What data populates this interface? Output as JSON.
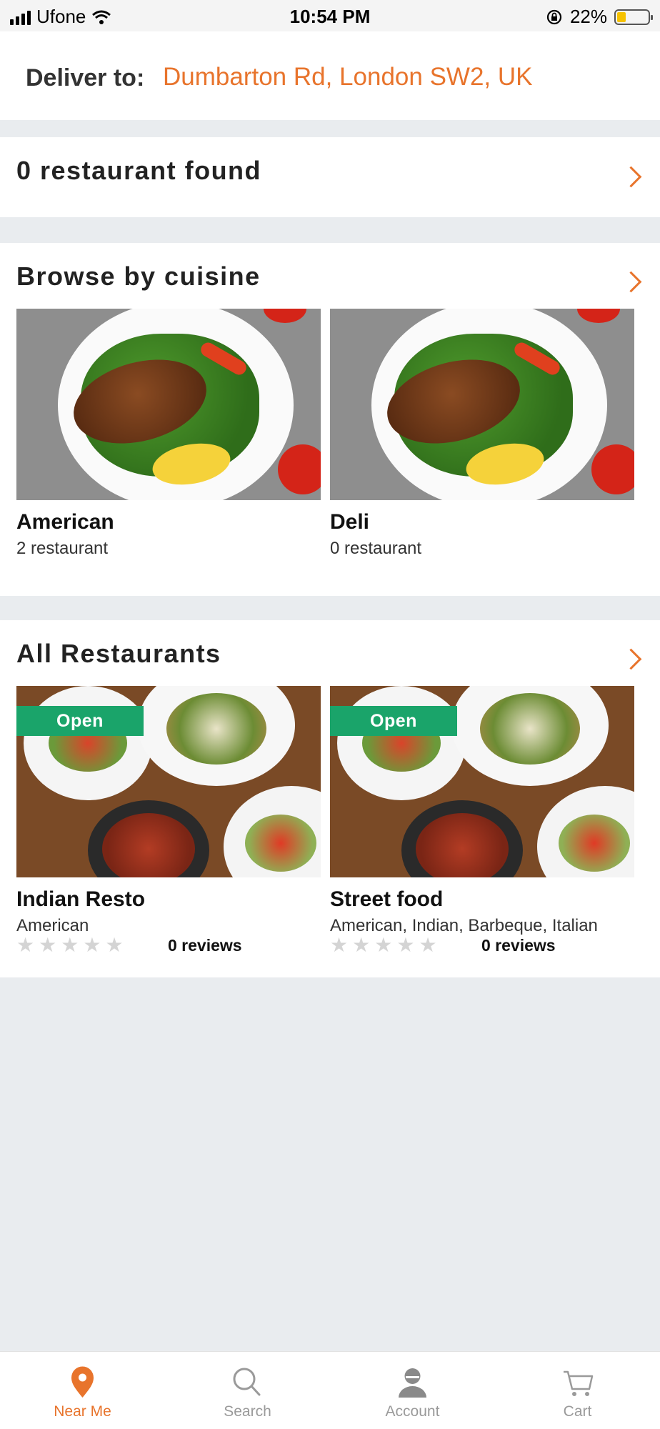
{
  "status_bar": {
    "carrier": "Ufone",
    "time": "10:54 PM",
    "battery": "22%"
  },
  "deliver": {
    "label": "Deliver to:",
    "address": "Dumbarton Rd, London SW2, UK"
  },
  "restaurants_found": {
    "text": "0 restaurant found"
  },
  "cuisine": {
    "title": "Browse by cuisine",
    "items": [
      {
        "name": "American",
        "count": "2 restaurant"
      },
      {
        "name": "Deli",
        "count": "0 restaurant"
      }
    ]
  },
  "all_restaurants": {
    "title": "All Restaurants",
    "items": [
      {
        "badge": "Open",
        "name": "Indian Resto",
        "cuisines": "American",
        "reviews": "0 reviews",
        "rating": 0
      },
      {
        "badge": "Open",
        "name": "Street food",
        "cuisines": "American, Indian, Barbeque, Italian",
        "reviews": "0 reviews",
        "rating": 0
      }
    ]
  },
  "tabs": [
    {
      "label": "Near Me",
      "icon": "location-pin-icon",
      "active": true
    },
    {
      "label": "Search",
      "icon": "search-icon",
      "active": false
    },
    {
      "label": "Account",
      "icon": "account-icon",
      "active": false
    },
    {
      "label": "Cart",
      "icon": "cart-icon",
      "active": false
    }
  ],
  "colors": {
    "accent": "#e8742c",
    "open_badge": "#1aa46a",
    "background": "#e9ecef"
  }
}
